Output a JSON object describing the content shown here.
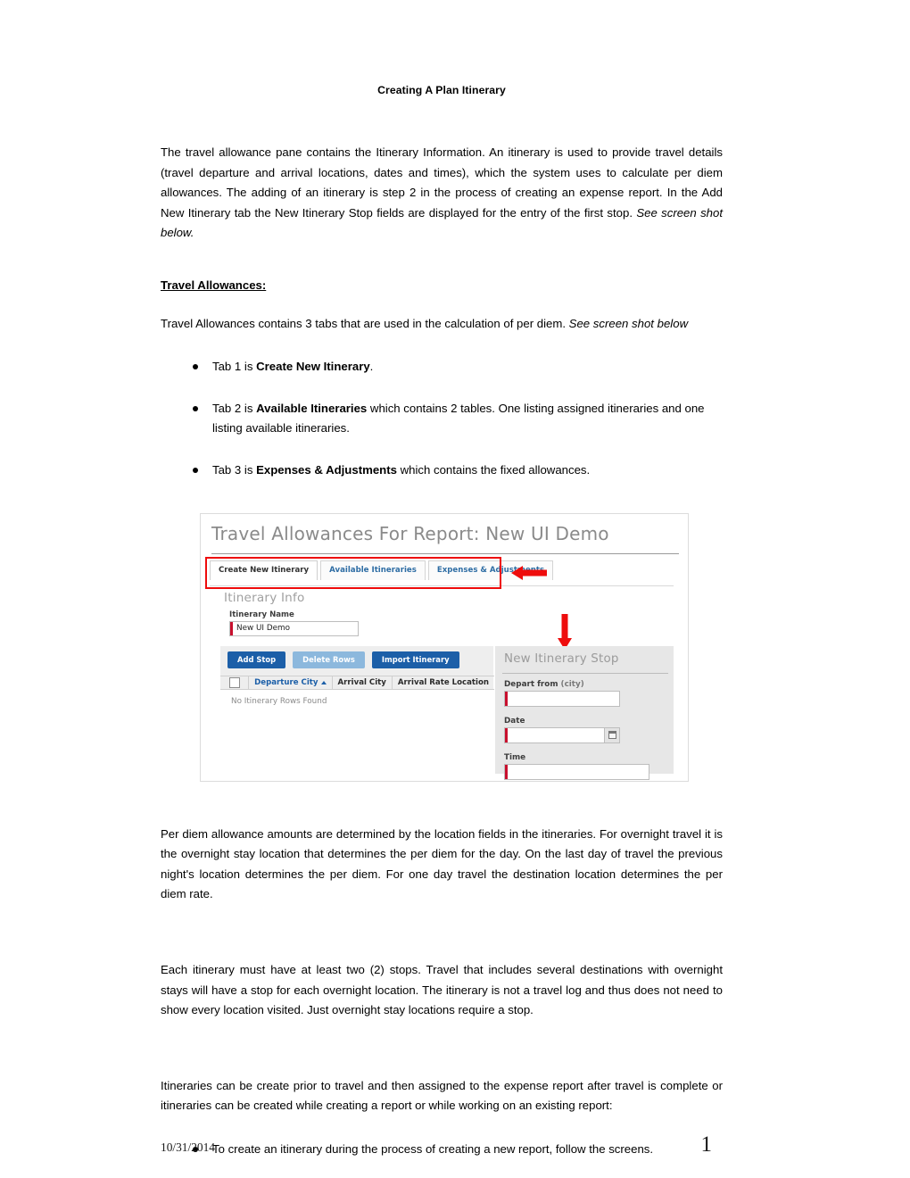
{
  "document": {
    "title": "Creating A Plan Itinerary",
    "intro_paragraph": "The travel allowance pane contains the Itinerary Information. An itinerary is used to provide travel details (travel departure and arrival locations, dates and times), which the system uses to calculate per diem allowances. The adding of an itinerary is step 2 in the process of creating an expense report. In the Add New Itinerary tab the New Itinerary Stop fields are displayed for the entry of the first stop. ",
    "intro_paragraph_italic_tail": "See screen shot below.",
    "section_heading": "Travel Allowances:",
    "section_lead": "Travel Allowances contains 3 tabs that are used in the calculation of per diem. ",
    "section_lead_italic_tail": "See screen shot below",
    "bullets": [
      {
        "prefix": "Tab 1 is ",
        "bold": "Create New Itinerary",
        "suffix": "."
      },
      {
        "prefix": "Tab 2 is ",
        "bold": "Available Itineraries",
        "suffix": " which contains 2 tables. One listing assigned itineraries and one listing available itineraries."
      },
      {
        "prefix": "Tab 3 is ",
        "bold": "Expenses & Adjustments",
        "suffix": " which contains the fixed allowances."
      }
    ],
    "paragraph_per_diem": "Per diem allowance amounts are determined by the location fields in the itineraries. For overnight travel it is the overnight stay location that determines the per diem for the day. On the last day of travel the previous night's location determines the per diem. For one day travel the destination location determines the per diem rate.",
    "paragraph_stops": "Each itinerary must have at least two (2) stops. Travel that includes several destinations with overnight stays will have a stop for each overnight location. The itinerary is not a travel log and thus does not need to show every location visited. Just overnight stay locations require a stop.",
    "paragraph_create": "Itineraries can be create prior to travel and then assigned to the expense report after travel is complete or itineraries can be created while creating a report or while working on an existing report:",
    "bullets_final": [
      {
        "prefix": "To create an itinerary during the process of creating a new report, follow the screens.",
        "bold": "",
        "suffix": ""
      }
    ]
  },
  "screenshot": {
    "title": "Travel Allowances For Report: New UI Demo",
    "tabs": [
      {
        "label": "Create New Itinerary",
        "active": true
      },
      {
        "label": "Available Itineraries",
        "active": false
      },
      {
        "label": "Expenses & Adjustments",
        "active": false
      }
    ],
    "itinerary_info": {
      "section_label": "Itinerary Info",
      "name_label": "Itinerary Name",
      "name_value": "New UI Demo"
    },
    "buttons": {
      "add_stop": "Add Stop",
      "delete_rows": "Delete Rows",
      "import_itinerary": "Import Itinerary"
    },
    "grid": {
      "columns": [
        "Departure City",
        "Arrival City",
        "Arrival Rate Location"
      ],
      "empty_message": "No Itinerary Rows Found",
      "sorted_column": "Departure City"
    },
    "stop_panel": {
      "title": "New Itinerary Stop",
      "fields": [
        {
          "label": "Depart from ",
          "label_muted": "(city)",
          "value": ""
        },
        {
          "label": "Date",
          "label_muted": "",
          "value": ""
        },
        {
          "label": "Time",
          "label_muted": "",
          "value": ""
        }
      ]
    },
    "annotation_color": "#ee0c0c",
    "accent_color": "#1c5fa8",
    "required_marker_color": "#c8102e"
  },
  "footer": {
    "date": "10/31/2014",
    "page_number": "1"
  }
}
